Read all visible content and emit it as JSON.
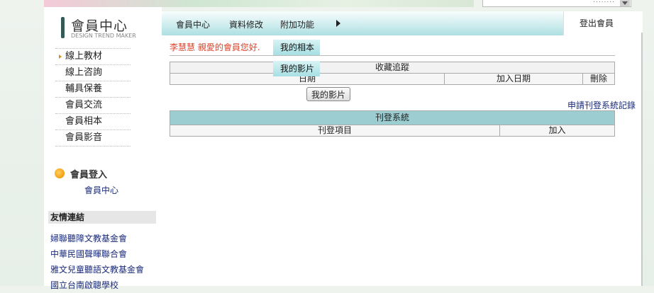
{
  "top": {
    "search_dots": "........"
  },
  "logo": {
    "title": "會員中心",
    "subtitle": "DESIGN TREND MAKER"
  },
  "sidebar": {
    "items": [
      {
        "label": "線上教材",
        "active": true
      },
      {
        "label": "線上咨詢"
      },
      {
        "label": "輔具保養"
      },
      {
        "label": "會員交流"
      },
      {
        "label": "會員相本"
      },
      {
        "label": "會員影音"
      }
    ],
    "member_login": {
      "label": "會員登入",
      "link": "會員中心"
    },
    "friends": {
      "title": "友情連結",
      "links": [
        "婦聯聽障文教基金會",
        "中華民國聲暉聯合會",
        "雅文兒童聽語文教基金會",
        "國立台南啟聰學校"
      ]
    }
  },
  "tabs": [
    "會員中心",
    "資料修改",
    "附加功能"
  ],
  "logout": "登出會員",
  "greeting": "李慧慧 親愛的會員您好.",
  "dropdown": [
    "我的相本",
    "我的影片"
  ],
  "favorites": {
    "title": "收藏追蹤",
    "columns": [
      "日期",
      "加入日期",
      "刪除"
    ]
  },
  "video_button": "我的影片",
  "apply_link": "申請刊登系統記錄",
  "publish": {
    "title": "刊登系統",
    "columns": [
      "刊登項目",
      "加入"
    ]
  }
}
